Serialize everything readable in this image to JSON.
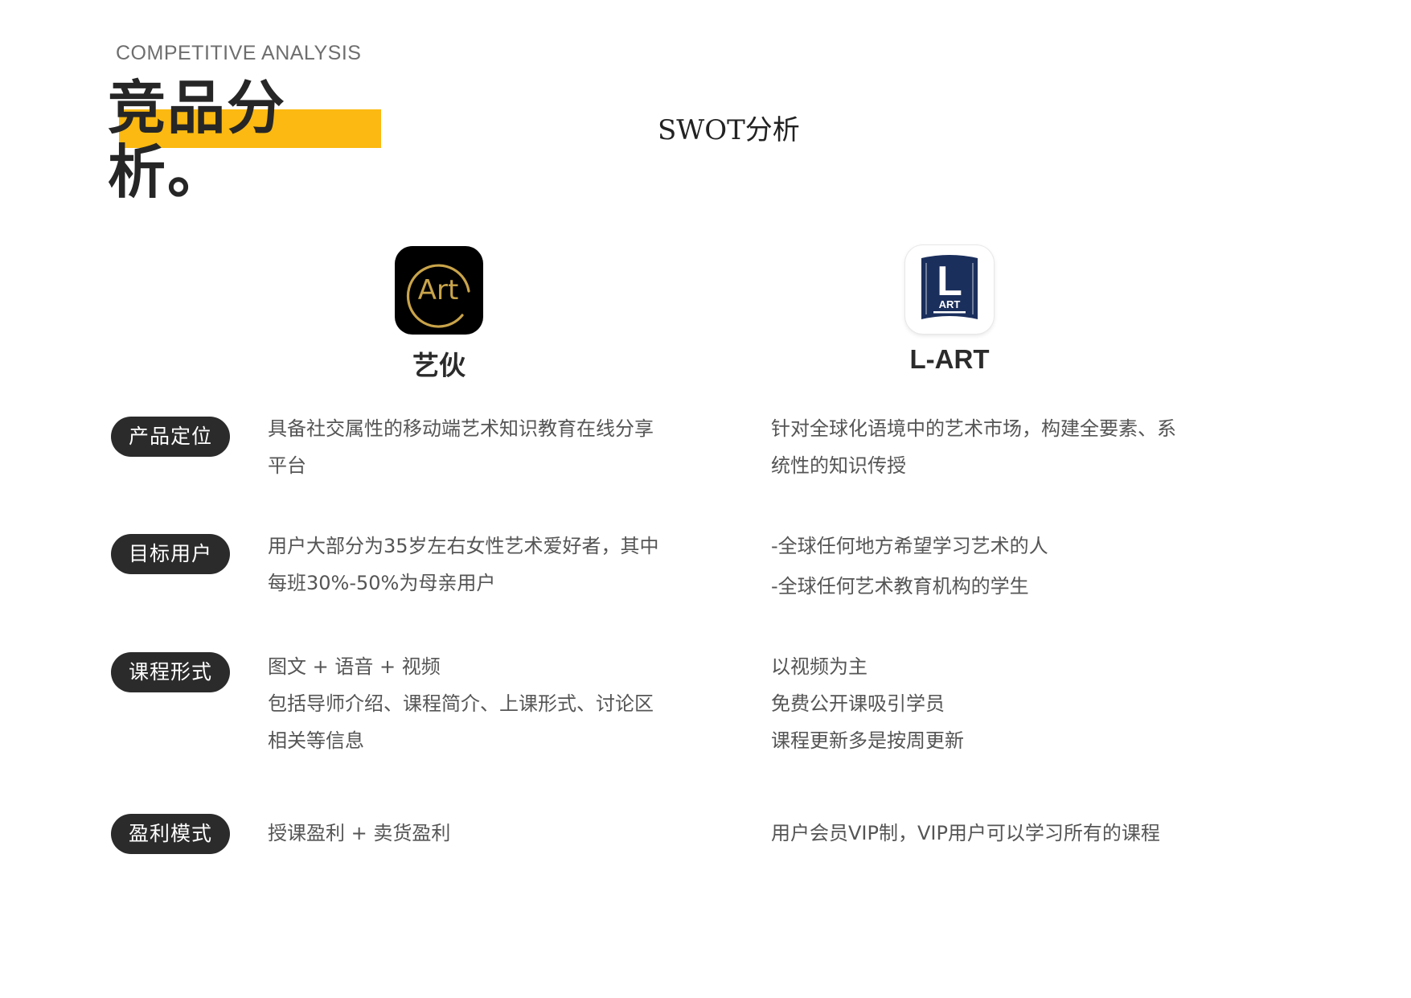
{
  "header": {
    "eyebrow": "COMPETITIVE  ANALYSIS",
    "title": "竞品分析。",
    "subtitle": "SWOT分析"
  },
  "colors": {
    "accent": "#fbb911",
    "badge_bg": "#2b2b2b",
    "lart_blue": "#1b2f5c",
    "art_gold": "#c9a44a"
  },
  "apps": [
    {
      "name": "艺伙",
      "icon": "art-logo-icon",
      "icon_text": "Art"
    },
    {
      "name": "L-ART",
      "icon": "lart-book-logo-icon",
      "icon_text_big": "L",
      "icon_text_small": "ART"
    }
  ],
  "rows": [
    {
      "label": "产品定位",
      "col_a": [
        "具备社交属性的移动端艺术知识教育在线分享",
        "平台"
      ],
      "col_b": [
        "针对全球化语境中的艺术市场，构建全要素、系",
        "统性的知识传授"
      ]
    },
    {
      "label": "目标用户",
      "col_a": [
        "用户大部分为35岁左右女性艺术爱好者，其中",
        "每班30%-50%为母亲用户"
      ],
      "col_b": [
        "-全球任何地方希望学习艺术的人",
        "-全球任何艺术教育机构的学生"
      ]
    },
    {
      "label": "课程形式",
      "col_a": [
        "图文 + 语音 + 视频",
        "包括导师介绍、课程简介、上课形式、讨论区",
        "相关等信息"
      ],
      "col_b": [
        "以视频为主",
        "免费公开课吸引学员",
        "课程更新多是按周更新"
      ]
    },
    {
      "label": "盈利模式",
      "col_a": [
        "授课盈利 + 卖货盈利"
      ],
      "col_b": [
        "用户会员VIP制，VIP用户可以学习所有的课程"
      ]
    }
  ]
}
